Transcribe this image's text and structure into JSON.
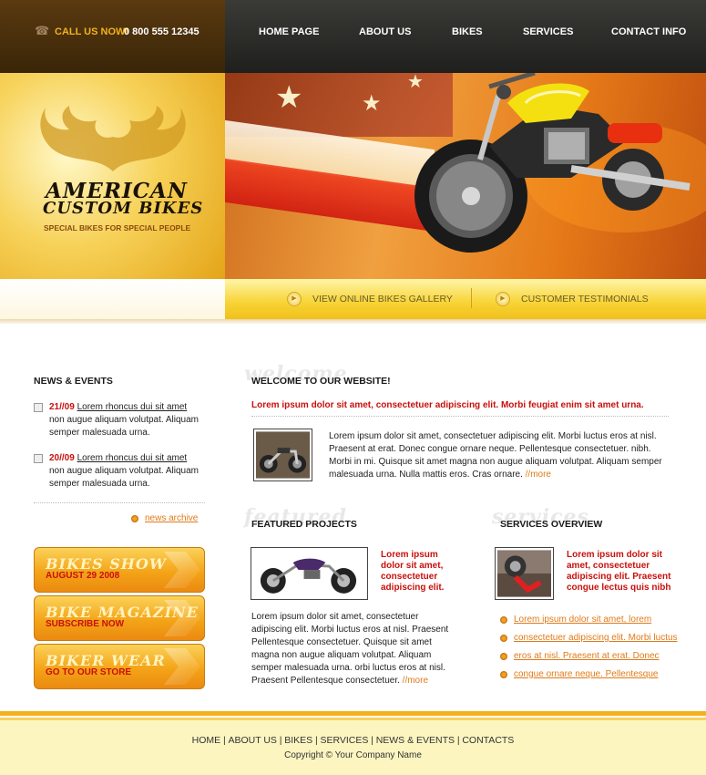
{
  "header": {
    "call_label": "CALL US NOW!",
    "call_number": "0 800 555 12345",
    "nav": [
      "HOME PAGE",
      "ABOUT US",
      "BIKES",
      "SERVICES",
      "CONTACT INFO"
    ]
  },
  "logo": {
    "title_line1": "AMERICAN",
    "title_line2": "CUSTOM BIKES",
    "tagline": "SPECIAL BIKES FOR SPECIAL PEOPLE"
  },
  "strip": {
    "gallery_link": "VIEW ONLINE BIKES GALLERY",
    "testimonials_link": "CUSTOMER TESTIMONIALS"
  },
  "news": {
    "heading": "NEWS & EVENTS",
    "items": [
      {
        "date": "21//09",
        "link": "Lorem rhoncus dui sit amet",
        "text": "non augue aliquam volutpat. Aliquam semper malesuada urna."
      },
      {
        "date": "20//09",
        "link": "Lorem rhoncus dui sit amet",
        "text": "non augue aliquam volutpat. Aliquam semper malesuada urna."
      }
    ],
    "archive_link": "news archive"
  },
  "promos": [
    {
      "title": "BIKES SHOW",
      "sub": "AUGUST 29 2008"
    },
    {
      "title": "BIKE MAGAZINE",
      "sub": "SUBSCRIBE NOW"
    },
    {
      "title": "BIKER WEAR",
      "sub": "GO TO OUR STORE"
    }
  ],
  "welcome": {
    "ghost": "welcome",
    "heading": "WELCOME TO OUR WEBSITE!",
    "lead": "Lorem ipsum dolor sit amet, consectetuer adipiscing elit. Morbi feugiat enim sit amet urna.",
    "body": "Lorem ipsum dolor sit amet, consectetuer adipiscing elit. Morbi luctus eros at nisl. Praesent at erat. Donec congue ornare neque. Pellentesque consectetuer. nibh. Morbi in mi. Quisque sit amet magna non augue aliquam volutpat. Aliquam semper malesuada urna. Nulla mattis eros. Cras ornare. ",
    "more": "//more"
  },
  "featured": {
    "ghost": "featured",
    "heading": "FEATURED PROJECTS",
    "caption": "Lorem ipsum dolor sit amet, consectetuer adipiscing elit.",
    "body": "Lorem ipsum dolor sit amet, consectetuer adipiscing elit. Morbi luctus eros at nisl. Praesent Pellentesque consectetuer. Quisque sit amet magna non augue aliquam volutpat. Aliquam semper malesuada urna. orbi luctus eros at nisl. Praesent Pellentesque consectetuer. ",
    "more": "//more"
  },
  "services": {
    "ghost": "services",
    "heading": "SERVICES OVERVIEW",
    "caption": "Lorem ipsum dolor sit amet, consectetuer adipiscing elit. Praesent congue lectus quis nibh",
    "links": [
      "Lorem ipsum dolor sit amet, lorem",
      "consectetuer adipiscing elit. Morbi luctus",
      "eros at nisl. Praesent at erat. Donec",
      "congue ornare neque. Pellentesque"
    ]
  },
  "footer": {
    "links": [
      "HOME",
      "ABOUT US",
      "BIKES",
      "SERVICES",
      "NEWS & EVENTS",
      "CONTACTS"
    ],
    "copyright": "Copyright © Your Company Name"
  },
  "colors": {
    "accent_orange": "#f2b21e",
    "accent_red": "#c8100c",
    "link_orange": "#e07a18"
  }
}
